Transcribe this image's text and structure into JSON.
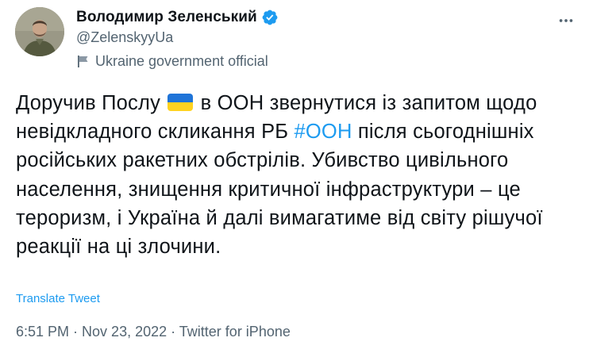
{
  "author": {
    "display_name": "Володимир Зеленський",
    "handle": "@ZelenskyyUa",
    "label": "Ukraine government official"
  },
  "tweet": {
    "part1": "Доручив Послу ",
    "part2": " в ООН звернутися із запитом щодо невідкладного скликання РБ ",
    "hashtag": "#ООН",
    "part3": " після сьогоднішніх російських ракетних обстрілів. Убивство цивільного населення, знищення критичної інфраструктури – це тероризм, і Україна й далі вимагатиме від світу рішучої реакції на ці злочини."
  },
  "translate_label": "Translate Tweet",
  "meta": {
    "time": "6:51 PM",
    "separator": " · ",
    "date": "Nov 23, 2022",
    "source": "Twitter for iPhone"
  },
  "colors": {
    "accent": "#1d9bf0",
    "secondary_text": "#536471",
    "primary_text": "#0f1419",
    "flag_blue": "#1f74d8",
    "flag_yellow": "#ffd21f"
  },
  "icons": {
    "verified": "verified-badge-icon",
    "label": "government-flag-icon",
    "more": "more-dots-icon"
  }
}
